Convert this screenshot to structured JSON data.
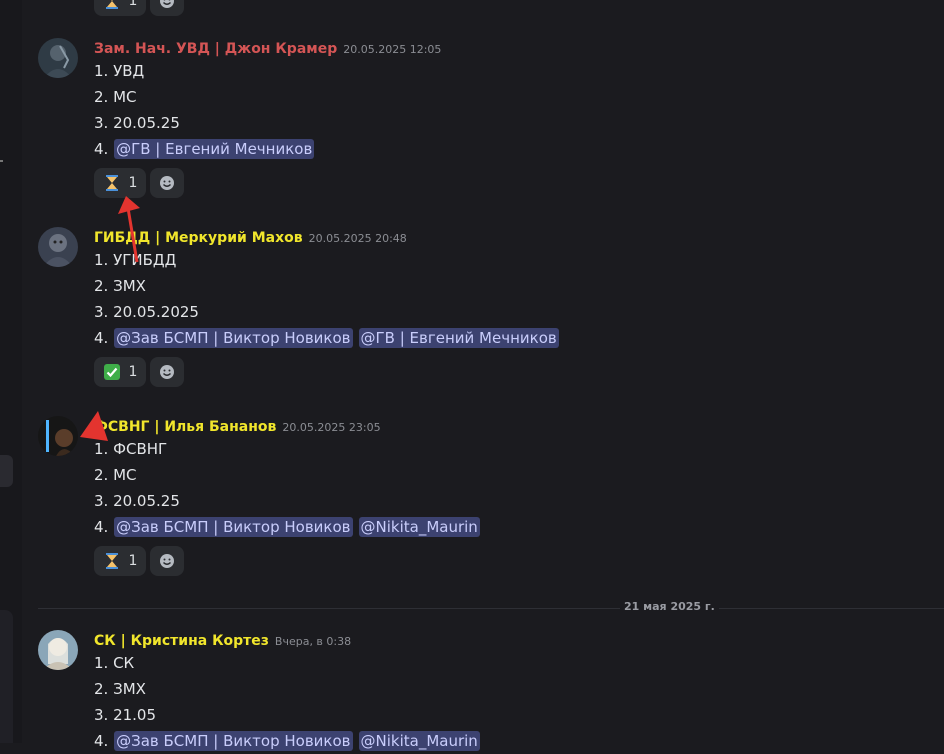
{
  "colors": {
    "background": "#1b1b1f",
    "author_red": "#d45555",
    "author_yellow": "#f1e62c",
    "mention_bg": "#3c4270",
    "mention_text": "#c9cdfb",
    "annotation_arrow": "#e3342f"
  },
  "top_reaction": {
    "emoji": "hourglass-icon",
    "count": "1"
  },
  "messages": [
    {
      "author": "Зам. Нач. УВД | Джон Крамер",
      "author_color": "#d45555",
      "timestamp": "20.05.2025 12:05",
      "lines": [
        "1. УВД",
        "2. МС",
        "3. 20.05.25",
        "4. "
      ],
      "mentions": [
        "@ГВ | Евгений Мечников"
      ],
      "reaction": {
        "emoji": "hourglass-icon",
        "count": "1"
      }
    },
    {
      "author": "ГИБДД | Меркурий Махов",
      "author_color": "#f1e62c",
      "timestamp": "20.05.2025 20:48",
      "lines": [
        "1. УГИБДД",
        "2. ЗМХ",
        "3. 20.05.2025",
        "4. "
      ],
      "mentions": [
        "@Зав БСМП | Виктор Новиков",
        "@ГВ | Евгений Мечников"
      ],
      "reaction": {
        "emoji": "check-mark-icon",
        "count": "1"
      }
    },
    {
      "author": "ФСВНГ | Илья Бананов",
      "author_color": "#f1e62c",
      "timestamp": "20.05.2025 23:05",
      "lines": [
        "1. ФСВНГ",
        "2. МС",
        "3. 20.05.25",
        "4. "
      ],
      "mentions": [
        "@Зав БСМП | Виктор Новиков",
        "@Nikita_Maurin"
      ],
      "reaction": {
        "emoji": "hourglass-icon",
        "count": "1"
      }
    },
    {
      "author": "СК | Кристина Кортез",
      "author_color": "#f1e62c",
      "timestamp": "Вчера, в 0:38",
      "lines": [
        "1. СК",
        "2. ЗМХ",
        "3. 21.05",
        "4. "
      ],
      "mentions": [
        "@Зав БСМП | Виктор Новиков",
        "@Nikita_Maurin"
      ]
    }
  ],
  "date_divider": "21 мая 2025 г."
}
